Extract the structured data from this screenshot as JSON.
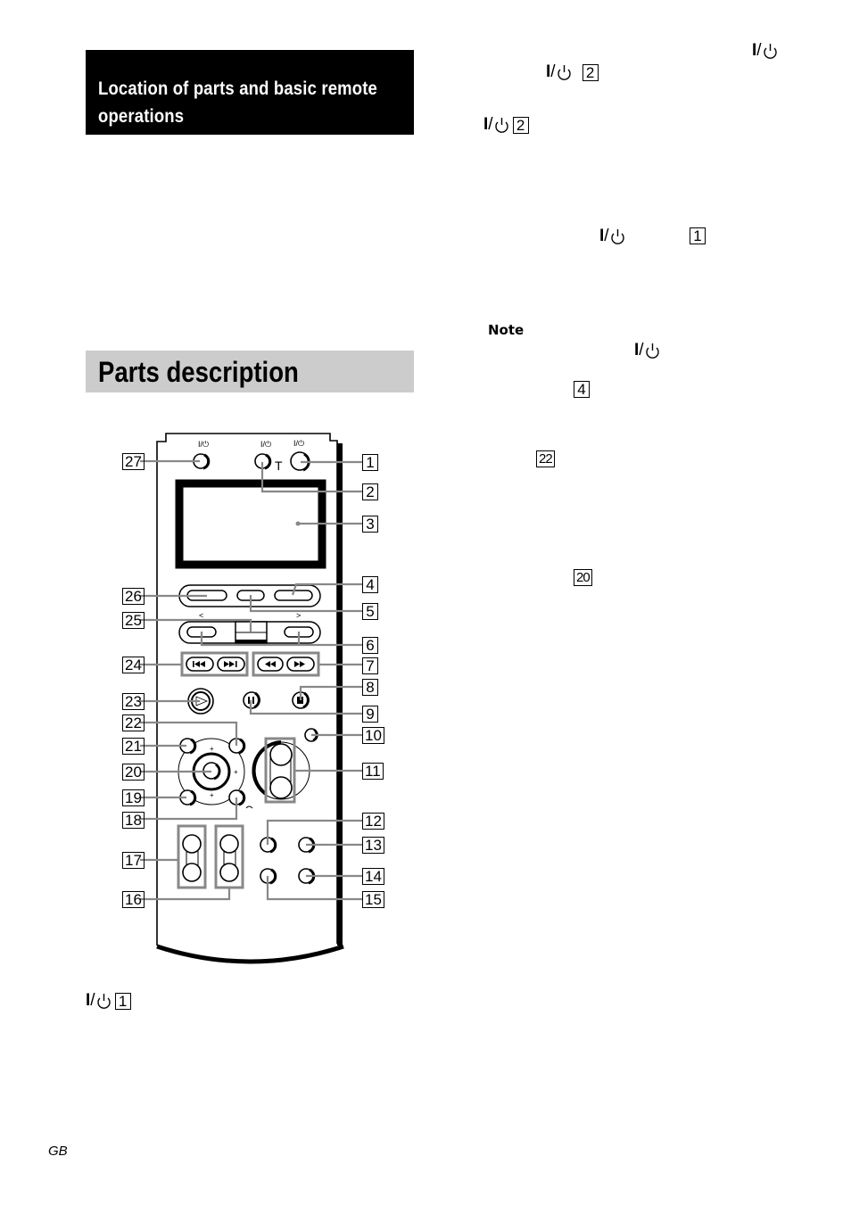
{
  "section_header": {
    "line1": "Location of parts and basic remote",
    "line2": "operations"
  },
  "parts_header": "Parts description",
  "power_symbol": "I/⏻",
  "right_column": {
    "refs": [
      {
        "id": "ref-power-top-right",
        "number": null
      },
      {
        "id": "ref-power-2a",
        "number": "2"
      },
      {
        "id": "ref-power-2b",
        "number": "2"
      },
      {
        "id": "ref-power-1",
        "number": "1"
      },
      {
        "id": "ref-power-note",
        "number": null
      },
      {
        "id": "ref-4",
        "number": "4"
      },
      {
        "id": "ref-22",
        "number": "22"
      },
      {
        "id": "ref-20",
        "number": "20"
      }
    ],
    "note_label": "Note"
  },
  "remote": {
    "top_button_labels": [
      "I/⏻",
      "I/⏻",
      "I/⏻"
    ],
    "t_mark": "T",
    "left_arrow": "<",
    "right_arrow": ">",
    "callouts_left": [
      "27",
      "26",
      "25",
      "24",
      "23",
      "22",
      "21",
      "20",
      "19",
      "18",
      "17",
      "16"
    ],
    "callouts_right": [
      "1",
      "2",
      "3",
      "4",
      "5",
      "6",
      "7",
      "8",
      "9",
      "10",
      "11",
      "12",
      "13",
      "14",
      "15"
    ]
  },
  "bottom_ref": {
    "number": "1"
  },
  "footer": "GB"
}
